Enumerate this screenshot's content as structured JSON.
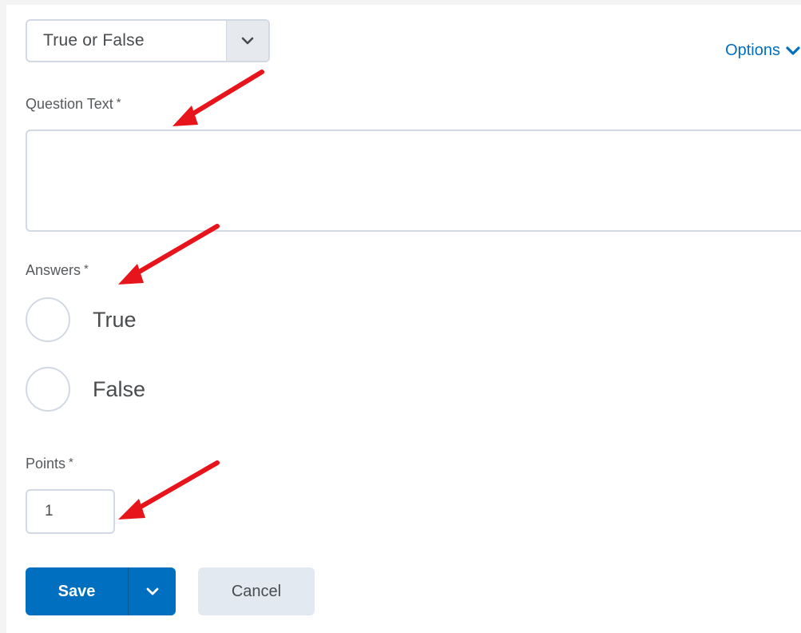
{
  "question_type": {
    "selected": "True or False",
    "icon": "chevron-down-icon"
  },
  "options_link": {
    "label": "Options",
    "icon": "chevron-down-icon"
  },
  "question_text": {
    "label": "Question Text",
    "required_marker": "*",
    "value": ""
  },
  "answers": {
    "label": "Answers",
    "required_marker": "*",
    "choices": [
      {
        "label": "True",
        "selected": false
      },
      {
        "label": "False",
        "selected": false
      }
    ]
  },
  "points": {
    "label": "Points",
    "required_marker": "*",
    "value": "1"
  },
  "actions": {
    "save_label": "Save",
    "save_menu_icon": "chevron-down-icon",
    "cancel_label": "Cancel"
  },
  "colors": {
    "accent": "#006fbf",
    "annotation_arrow": "#e8141b",
    "border": "#d3d9e3"
  }
}
